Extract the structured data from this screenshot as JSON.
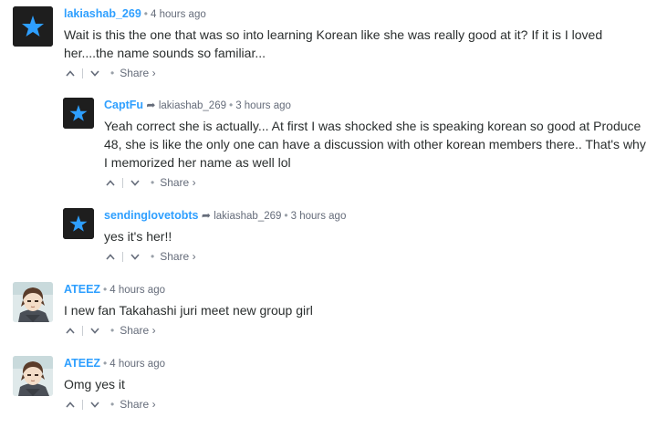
{
  "comments": [
    {
      "author": "lakiashab_269",
      "reply_to": "",
      "time": "4 hours ago",
      "text_lines": [
        "Wait is this the one that was so into learning Korean like she was really good at it? If it is I loved",
        "her....the name sounds so familiar..."
      ],
      "share_label": "Share",
      "avatar": "star-avatar"
    },
    {
      "author": "CaptFu",
      "reply_to": "lakiashab_269",
      "time": "3 hours ago",
      "text_lines": [
        "Yeah correct she is actually... At first I was shocked she is speaking korean so good at Produce",
        "48, she is like the only one can have a discussion with other korean members there.. That's why",
        "I memorized her name as well lol"
      ],
      "share_label": "Share",
      "avatar": "star-avatar"
    },
    {
      "author": "sendinglovetobts",
      "reply_to": "lakiashab_269",
      "time": "3 hours ago",
      "text_lines": [
        "yes it's her!!"
      ],
      "share_label": "Share",
      "avatar": "star-avatar"
    },
    {
      "author": "ATEEZ",
      "reply_to": "",
      "time": "4 hours ago",
      "text_lines": [
        "I new fan Takahashi juri meet new group girl"
      ],
      "share_label": "Share",
      "avatar": "anime-avatar"
    },
    {
      "author": "ATEEZ",
      "reply_to": "",
      "time": "4 hours ago",
      "text_lines": [
        "Omg yes it"
      ],
      "share_label": "Share",
      "avatar": "anime-avatar"
    }
  ],
  "symbols": {
    "dot": "•",
    "share_chevron": "›",
    "reply_arrow": "➦"
  },
  "colors": {
    "author": "#2e9fff",
    "meta": "#656c7a",
    "star": "#2e9fff",
    "avatar_bg": "#1e1e1e"
  }
}
